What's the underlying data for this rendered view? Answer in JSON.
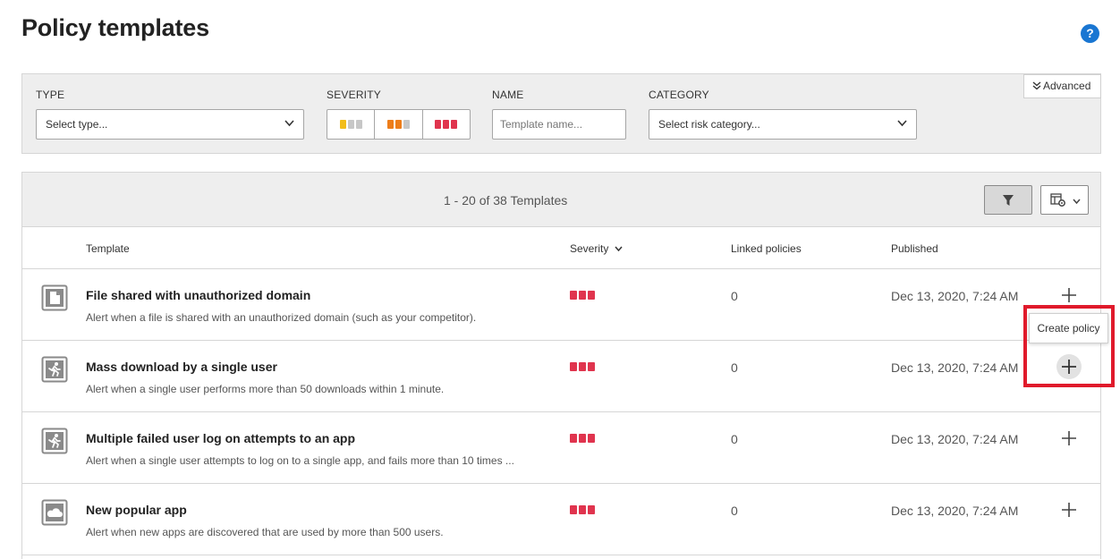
{
  "page": {
    "title": "Policy templates",
    "help_symbol": "?"
  },
  "filters": {
    "type": {
      "label": "TYPE",
      "placeholder": "Select type..."
    },
    "severity": {
      "label": "SEVERITY",
      "levels": [
        {
          "name": "low",
          "colors": [
            "#f2bd1a",
            "#c7c7c7",
            "#c7c7c7"
          ]
        },
        {
          "name": "medium",
          "colors": [
            "#ed7d1a",
            "#ed7d1a",
            "#c7c7c7"
          ]
        },
        {
          "name": "high",
          "colors": [
            "#e0344e",
            "#e0344e",
            "#e0344e"
          ]
        }
      ]
    },
    "name": {
      "label": "NAME",
      "placeholder": "Template name..."
    },
    "category": {
      "label": "CATEGORY",
      "placeholder": "Select risk category..."
    },
    "advanced_label": "Advanced"
  },
  "table": {
    "count_text": "1 - 20 of 38 Templates",
    "headers": {
      "template": "Template",
      "severity": "Severity",
      "linked": "Linked policies",
      "published": "Published"
    },
    "rows": [
      {
        "icon": "file-share-icon",
        "title": "File shared with unauthorized domain",
        "desc": "Alert when a file is shared with an unauthorized domain (such as your competitor).",
        "severity": "high",
        "linked": "0",
        "published": "Dec 13, 2020, 7:24 AM"
      },
      {
        "icon": "user-activity-icon",
        "title": "Mass download by a single user",
        "desc": "Alert when a single user performs more than 50 downloads within 1 minute.",
        "severity": "high",
        "linked": "0",
        "published": "Dec 13, 2020, 7:24 AM"
      },
      {
        "icon": "user-activity-icon",
        "title": "Multiple failed user log on attempts to an app",
        "desc": "Alert when a single user attempts to log on to a single app, and fails more than 10 times ...",
        "severity": "high",
        "linked": "0",
        "published": "Dec 13, 2020, 7:24 AM"
      },
      {
        "icon": "cloud-app-icon",
        "title": "New popular app",
        "desc": "Alert when new apps are discovered that are used by more than 500 users.",
        "severity": "high",
        "linked": "0",
        "published": "Dec 13, 2020, 7:24 AM"
      }
    ]
  },
  "tooltip": {
    "text": "Create policy"
  },
  "colors": {
    "accent": "#1976d2",
    "severity_high": "#e0344e",
    "highlight": "#e01a2b"
  }
}
